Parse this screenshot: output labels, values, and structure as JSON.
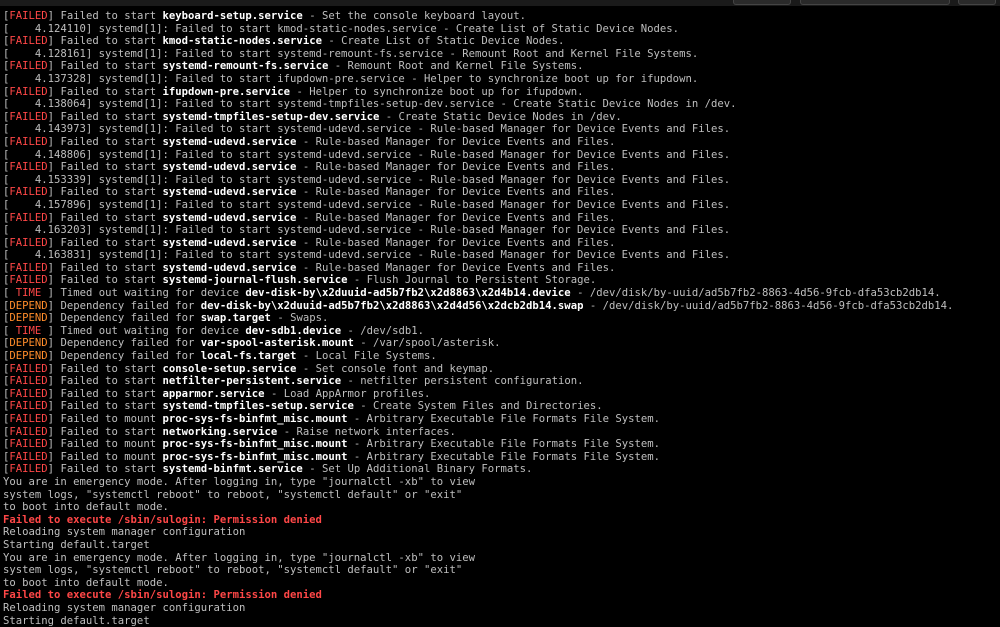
{
  "colors": {
    "background": "#000000",
    "text": "#bfbfbf",
    "failed": "#ff4747",
    "depend": "#ff8c2a",
    "highlight": "#ffffff"
  },
  "lines": [
    {
      "kind": "status",
      "tag": "FAILED",
      "pre": " Failed to start ",
      "unit": "keyboard-setup.service",
      "post": " - Set the console keyboard layout."
    },
    {
      "kind": "log",
      "text": "[    4.124110] systemd[1]: Failed to start kmod-static-nodes.service - Create List of Static Device Nodes."
    },
    {
      "kind": "status",
      "tag": "FAILED",
      "pre": " Failed to start ",
      "unit": "kmod-static-nodes.service",
      "post": " - Create List of Static Device Nodes."
    },
    {
      "kind": "log",
      "text": "[    4.128161] systemd[1]: Failed to start systemd-remount-fs.service - Remount Root and Kernel File Systems."
    },
    {
      "kind": "status",
      "tag": "FAILED",
      "pre": " Failed to start ",
      "unit": "systemd-remount-fs.service",
      "post": " - Remount Root and Kernel File Systems."
    },
    {
      "kind": "log",
      "text": "[    4.137328] systemd[1]: Failed to start ifupdown-pre.service - Helper to synchronize boot up for ifupdown."
    },
    {
      "kind": "status",
      "tag": "FAILED",
      "pre": " Failed to start ",
      "unit": "ifupdown-pre.service",
      "post": " - Helper to synchronize boot up for ifupdown."
    },
    {
      "kind": "log",
      "text": "[    4.138064] systemd[1]: Failed to start systemd-tmpfiles-setup-dev.service - Create Static Device Nodes in /dev."
    },
    {
      "kind": "status",
      "tag": "FAILED",
      "pre": " Failed to start ",
      "unit": "systemd-tmpfiles-setup-dev.service",
      "post": " - Create Static Device Nodes in /dev."
    },
    {
      "kind": "log",
      "text": "[    4.143973] systemd[1]: Failed to start systemd-udevd.service - Rule-based Manager for Device Events and Files."
    },
    {
      "kind": "status",
      "tag": "FAILED",
      "pre": " Failed to start ",
      "unit": "systemd-udevd.service",
      "post": " - Rule-based Manager for Device Events and Files."
    },
    {
      "kind": "log",
      "text": "[    4.148806] systemd[1]: Failed to start systemd-udevd.service - Rule-based Manager for Device Events and Files."
    },
    {
      "kind": "status",
      "tag": "FAILED",
      "pre": " Failed to start ",
      "unit": "systemd-udevd.service",
      "post": " - Rule-based Manager for Device Events and Files."
    },
    {
      "kind": "log",
      "text": "[    4.153339] systemd[1]: Failed to start systemd-udevd.service - Rule-based Manager for Device Events and Files."
    },
    {
      "kind": "status",
      "tag": "FAILED",
      "pre": " Failed to start ",
      "unit": "systemd-udevd.service",
      "post": " - Rule-based Manager for Device Events and Files."
    },
    {
      "kind": "log",
      "text": "[    4.157896] systemd[1]: Failed to start systemd-udevd.service - Rule-based Manager for Device Events and Files."
    },
    {
      "kind": "status",
      "tag": "FAILED",
      "pre": " Failed to start ",
      "unit": "systemd-udevd.service",
      "post": " - Rule-based Manager for Device Events and Files."
    },
    {
      "kind": "log",
      "text": "[    4.163203] systemd[1]: Failed to start systemd-udevd.service - Rule-based Manager for Device Events and Files."
    },
    {
      "kind": "status",
      "tag": "FAILED",
      "pre": " Failed to start ",
      "unit": "systemd-udevd.service",
      "post": " - Rule-based Manager for Device Events and Files."
    },
    {
      "kind": "log",
      "text": "[    4.163831] systemd[1]: Failed to start systemd-udevd.service - Rule-based Manager for Device Events and Files."
    },
    {
      "kind": "status",
      "tag": "FAILED",
      "pre": " Failed to start ",
      "unit": "systemd-udevd.service",
      "post": " - Rule-based Manager for Device Events and Files."
    },
    {
      "kind": "status",
      "tag": "FAILED",
      "pre": " Failed to start ",
      "unit": "systemd-journal-flush.service",
      "post": " - Flush Journal to Persistent Storage."
    },
    {
      "kind": "status",
      "tag": " TIME ",
      "pre": " Timed out waiting for device ",
      "unit": "dev-disk-by\\x2duuid-ad5b7fb2\\x2d8863\\x2d4b14.device",
      "post": " - /dev/disk/by-uuid/ad5b7fb2-8863-4d56-9fcb-dfa53cb2db14."
    },
    {
      "kind": "status",
      "tag": "DEPEND",
      "pre": " Dependency failed for ",
      "unit": "dev-disk-by\\x2duuid-ad5b7fb2\\x2d8863\\x2d4d56\\x2dcb2db14.swap",
      "post": " - /dev/disk/by-uuid/ad5b7fb2-8863-4d56-9fcb-dfa53cb2db14."
    },
    {
      "kind": "status",
      "tag": "DEPEND",
      "pre": " Dependency failed for ",
      "unit": "swap.target",
      "post": " - Swaps."
    },
    {
      "kind": "status",
      "tag": " TIME ",
      "pre": " Timed out waiting for device ",
      "unit": "dev-sdb1.device",
      "post": " - /dev/sdb1."
    },
    {
      "kind": "status",
      "tag": "DEPEND",
      "pre": " Dependency failed for ",
      "unit": "var-spool-asterisk.mount",
      "post": " - /var/spool/asterisk."
    },
    {
      "kind": "status",
      "tag": "DEPEND",
      "pre": " Dependency failed for ",
      "unit": "local-fs.target",
      "post": " - Local File Systems."
    },
    {
      "kind": "status",
      "tag": "FAILED",
      "pre": " Failed to start ",
      "unit": "console-setup.service",
      "post": " - Set console font and keymap."
    },
    {
      "kind": "status",
      "tag": "FAILED",
      "pre": " Failed to start ",
      "unit": "netfilter-persistent.service",
      "post": " - netfilter persistent configuration."
    },
    {
      "kind": "status",
      "tag": "FAILED",
      "pre": " Failed to start ",
      "unit": "apparmor.service",
      "post": " - Load AppArmor profiles."
    },
    {
      "kind": "status",
      "tag": "FAILED",
      "pre": " Failed to start ",
      "unit": "systemd-tmpfiles-setup.service",
      "post": " - Create System Files and Directories."
    },
    {
      "kind": "status",
      "tag": "FAILED",
      "pre": " Failed to mount ",
      "unit": "proc-sys-fs-binfmt_misc.mount",
      "post": " - Arbitrary Executable File Formats File System."
    },
    {
      "kind": "status",
      "tag": "FAILED",
      "pre": " Failed to start ",
      "unit": "networking.service",
      "post": " - Raise network interfaces."
    },
    {
      "kind": "status",
      "tag": "FAILED",
      "pre": " Failed to mount ",
      "unit": "proc-sys-fs-binfmt_misc.mount",
      "post": " - Arbitrary Executable File Formats File System."
    },
    {
      "kind": "status",
      "tag": "FAILED",
      "pre": " Failed to mount ",
      "unit": "proc-sys-fs-binfmt_misc.mount",
      "post": " - Arbitrary Executable File Formats File System."
    },
    {
      "kind": "status",
      "tag": "FAILED",
      "pre": " Failed to start ",
      "unit": "systemd-binfmt.service",
      "post": " - Set Up Additional Binary Formats."
    },
    {
      "kind": "plain",
      "text": "You are in emergency mode. After logging in, type \"journalctl -xb\" to view"
    },
    {
      "kind": "plain",
      "text": "system logs, \"systemctl reboot\" to reboot, \"systemctl default\" or \"exit\""
    },
    {
      "kind": "plain",
      "text": "to boot into default mode."
    },
    {
      "kind": "error",
      "text": "Failed to execute /sbin/sulogin: Permission denied"
    },
    {
      "kind": "plain",
      "text": "Reloading system manager configuration"
    },
    {
      "kind": "plain",
      "text": "Starting default.target"
    },
    {
      "kind": "plain",
      "text": "You are in emergency mode. After logging in, type \"journalctl -xb\" to view"
    },
    {
      "kind": "plain",
      "text": "system logs, \"systemctl reboot\" to reboot, \"systemctl default\" or \"exit\""
    },
    {
      "kind": "plain",
      "text": "to boot into default mode."
    },
    {
      "kind": "error",
      "text": "Failed to execute /sbin/sulogin: Permission denied"
    },
    {
      "kind": "plain",
      "text": "Reloading system manager configuration"
    },
    {
      "kind": "plain",
      "text": "Starting default.target"
    }
  ]
}
